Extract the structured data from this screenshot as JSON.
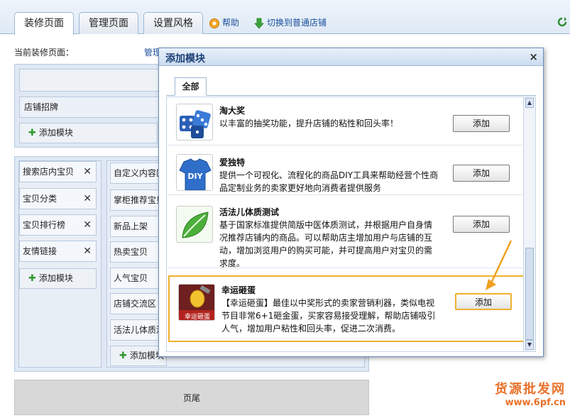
{
  "tabs": [
    {
      "label": "装修页面"
    },
    {
      "label": "管理页面"
    },
    {
      "label": "设置风格"
    }
  ],
  "links": {
    "help": "帮助",
    "switch": "切换到普通店铺"
  },
  "current_page": {
    "label": "当前装修页面：",
    "value": "管理页面"
  },
  "shop_sign": "店铺招牌",
  "add_module": "添加模块",
  "left_modules": [
    {
      "label": "搜索店内宝贝"
    },
    {
      "label": "宝贝分类"
    },
    {
      "label": "宝贝排行榜"
    },
    {
      "label": "友情链接"
    }
  ],
  "right_modules": [
    {
      "label": "自定义内容区"
    },
    {
      "label": "掌柜推荐宝贝"
    },
    {
      "label": "新品上架"
    },
    {
      "label": "热卖宝贝"
    },
    {
      "label": "人气宝贝"
    },
    {
      "label": "店铺交流区"
    },
    {
      "label": "活法儿体质测试"
    }
  ],
  "footer": "页尾",
  "modal": {
    "title": "添加模块",
    "close": "×",
    "tab_all": "全部",
    "add_label": "添加",
    "items": [
      {
        "name": "淘大奖",
        "desc": "以丰富的抽奖功能，提升店铺的粘性和回头率！",
        "icon": "dice-icon"
      },
      {
        "name": "爱独特",
        "desc": "提供一个可视化、流程化的商品DIY工具来帮助经营个性商品定制业务的卖家更好地向消费者提供服务",
        "icon": "diy-shirt-icon"
      },
      {
        "name": "活法儿体质测试",
        "desc": "基于国家标准提供简版中医体质测试，并根据用户自身情况推荐店铺内的商品。可以帮助店主增加用户与店铺的互动，增加浏览用户的购买可能，并可提高用户对宝贝的需求度。",
        "icon": "leaf-icon"
      },
      {
        "name": "幸运砸蛋",
        "desc": "【幸运砸蛋】最佳以中奖形式的卖家营销利器，类似电视节目非常6+1砸金蛋，买家容易接受理解，帮助店铺吸引人气，增加用户粘性和回头率，促进二次消费。",
        "icon": "lucky-egg-icon",
        "thumb_text": "幸运砸蛋"
      }
    ]
  },
  "watermark": {
    "line1": "货源批发网",
    "line2": "www.6pf.cn"
  },
  "colors": {
    "highlight": "#f0b030",
    "link": "#1b4f9c",
    "accent_green": "#2f9a2f"
  }
}
